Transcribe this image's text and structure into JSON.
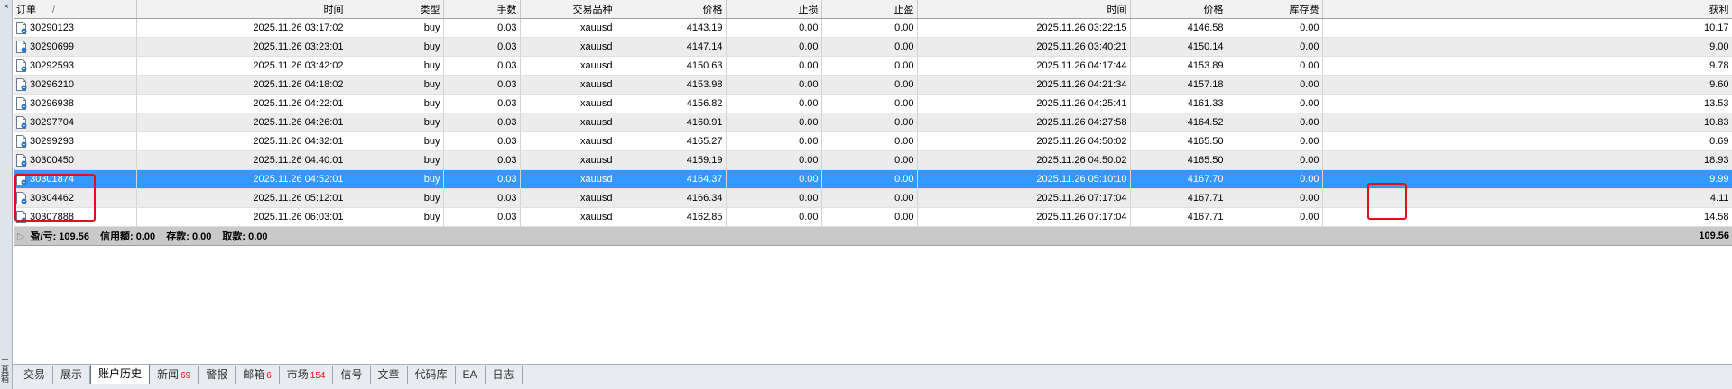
{
  "panel": {
    "title": "工具箱",
    "close_glyph": "×"
  },
  "columns": [
    "订单",
    "时间",
    "类型",
    "手数",
    "交易品种",
    "价格",
    "止损",
    "止盈",
    "时间",
    "价格",
    "库存费",
    "获利"
  ],
  "sort_indicator": "/",
  "rows": [
    [
      "30290123",
      "2025.11.26 03:17:02",
      "buy",
      "0.03",
      "xauusd",
      "4143.19",
      "0.00",
      "0.00",
      "2025.11.26 03:22:15",
      "4146.58",
      "0.00",
      "10.17"
    ],
    [
      "30290699",
      "2025.11.26 03:23:01",
      "buy",
      "0.03",
      "xauusd",
      "4147.14",
      "0.00",
      "0.00",
      "2025.11.26 03:40:21",
      "4150.14",
      "0.00",
      "9.00"
    ],
    [
      "30292593",
      "2025.11.26 03:42:02",
      "buy",
      "0.03",
      "xauusd",
      "4150.63",
      "0.00",
      "0.00",
      "2025.11.26 04:17:44",
      "4153.89",
      "0.00",
      "9.78"
    ],
    [
      "30296210",
      "2025.11.26 04:18:02",
      "buy",
      "0.03",
      "xauusd",
      "4153.98",
      "0.00",
      "0.00",
      "2025.11.26 04:21:34",
      "4157.18",
      "0.00",
      "9.60"
    ],
    [
      "30296938",
      "2025.11.26 04:22:01",
      "buy",
      "0.03",
      "xauusd",
      "4156.82",
      "0.00",
      "0.00",
      "2025.11.26 04:25:41",
      "4161.33",
      "0.00",
      "13.53"
    ],
    [
      "30297704",
      "2025.11.26 04:26:01",
      "buy",
      "0.03",
      "xauusd",
      "4160.91",
      "0.00",
      "0.00",
      "2025.11.26 04:27:58",
      "4164.52",
      "0.00",
      "10.83"
    ],
    [
      "30299293",
      "2025.11.26 04:32:01",
      "buy",
      "0.03",
      "xauusd",
      "4165.27",
      "0.00",
      "0.00",
      "2025.11.26 04:50:02",
      "4165.50",
      "0.00",
      "0.69"
    ],
    [
      "30300450",
      "2025.11.26 04:40:01",
      "buy",
      "0.03",
      "xauusd",
      "4159.19",
      "0.00",
      "0.00",
      "2025.11.26 04:50:02",
      "4165.50",
      "0.00",
      "18.93"
    ],
    [
      "30301874",
      "2025.11.26 04:52:01",
      "buy",
      "0.03",
      "xauusd",
      "4164.37",
      "0.00",
      "0.00",
      "2025.11.26 05:10:10",
      "4167.70",
      "0.00",
      "9.99"
    ],
    [
      "30304462",
      "2025.11.26 05:12:01",
      "buy",
      "0.03",
      "xauusd",
      "4166.34",
      "0.00",
      "0.00",
      "2025.11.26 07:17:04",
      "4167.71",
      "0.00",
      "4.11"
    ],
    [
      "30307888",
      "2025.11.26 06:03:01",
      "buy",
      "0.03",
      "xauusd",
      "4162.85",
      "0.00",
      "0.00",
      "2025.11.26 07:17:04",
      "4167.71",
      "0.00",
      "14.58"
    ]
  ],
  "selected_row": 8,
  "summary": {
    "profit": "盈/亏: 109.56",
    "credit": "信用额: 0.00",
    "deposit": "存款: 0.00",
    "withdrawal": "取款: 0.00",
    "total": "109.56"
  },
  "tabs": [
    {
      "label": "交易",
      "badge": ""
    },
    {
      "label": "展示",
      "badge": ""
    },
    {
      "label": "账户历史",
      "badge": "",
      "active": true
    },
    {
      "label": "新闻",
      "badge": "69"
    },
    {
      "label": "警报",
      "badge": ""
    },
    {
      "label": "邮箱",
      "badge": "6"
    },
    {
      "label": "市场",
      "badge": "154"
    },
    {
      "label": "信号",
      "badge": ""
    },
    {
      "label": "文章",
      "badge": ""
    },
    {
      "label": "代码库",
      "badge": ""
    },
    {
      "label": "EA",
      "badge": ""
    },
    {
      "label": "日志",
      "badge": ""
    }
  ],
  "colors": {
    "selection": "#3399ff",
    "annotation": "#e0101a",
    "badge": "#e8101a",
    "summary_bg": "#c9c9c9"
  },
  "icons": {
    "order_row": "document-icon"
  }
}
